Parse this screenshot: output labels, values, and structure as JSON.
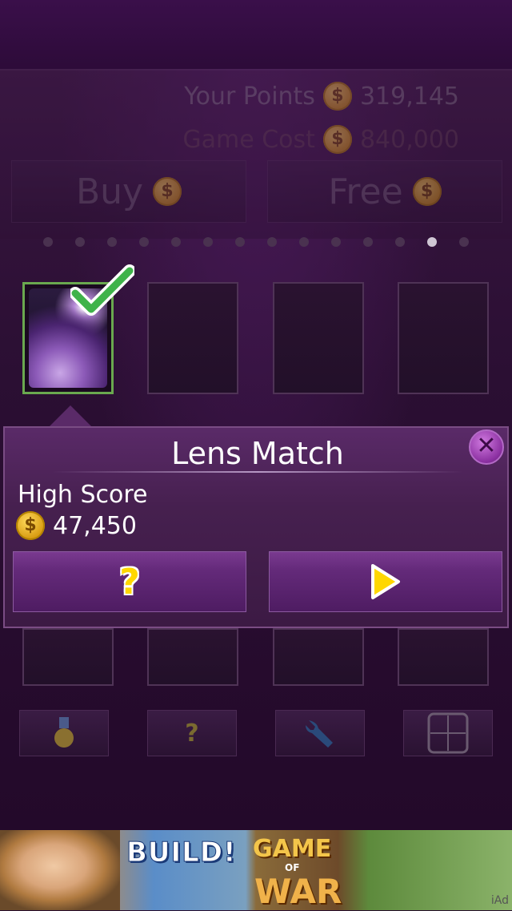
{
  "points": {
    "label": "Your Points",
    "value": "319,145",
    "coin_symbol": "$"
  },
  "cost": {
    "label": "Game Cost",
    "value": "840,000",
    "coin_symbol": "$"
  },
  "buttons": {
    "buy_label": "Buy",
    "free_label": "Free"
  },
  "pager": {
    "total_pages": 14,
    "current_page": 13
  },
  "popup": {
    "title": "Lens Match",
    "close_symbol": "✕",
    "high_score_label": "High Score",
    "high_score_value": "47,450",
    "help_symbol": "?",
    "play_icon": "play-icon"
  },
  "toolbar": {
    "icons": [
      "medal-icon",
      "help-icon",
      "wrench-icon",
      "settings-grid-icon"
    ],
    "help_symbol": "?"
  },
  "ad": {
    "word1": "BUILD!",
    "word2": "GAME",
    "word3": "OF",
    "word4": "WAR",
    "badge": "iAd"
  },
  "colors": {
    "accent_purple": "#642a7a",
    "selected_border": "#6aa84f",
    "coin_gold": "#ffd95a",
    "play_yellow": "#ffd700"
  }
}
